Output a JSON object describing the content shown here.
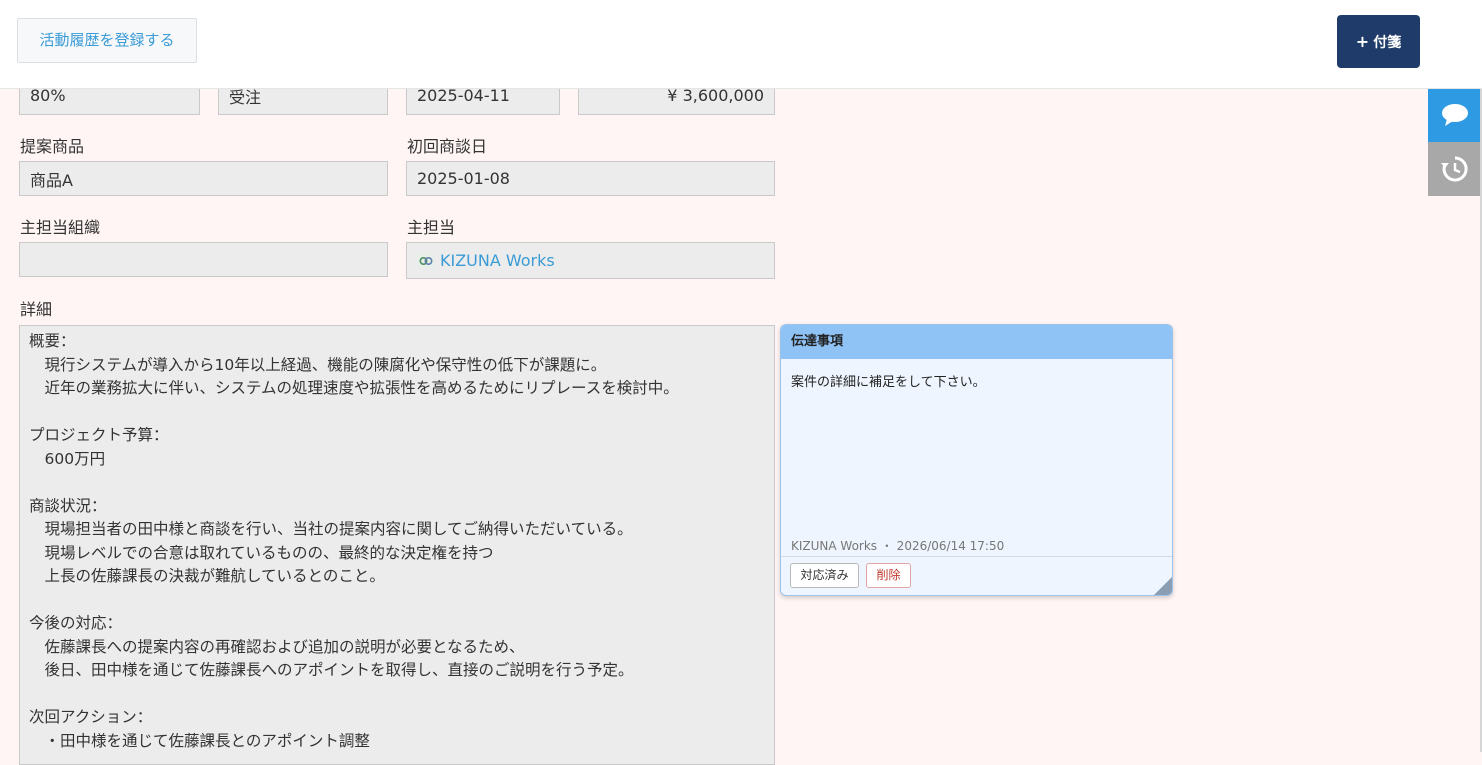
{
  "header": {
    "register_label": "活動履歴を登録する",
    "sticky_plus": "+",
    "sticky_label": "付箋"
  },
  "top_row": {
    "probability": "80%",
    "stage": "受注",
    "date": "2025-04-11",
    "amount": "¥ 3,600,000"
  },
  "form": {
    "product_label": "提案商品",
    "product_value": "商品A",
    "first_meeting_label": "初回商談日",
    "first_meeting_value": "2025-01-08",
    "org_label": "主担当組織",
    "org_value": "",
    "owner_label": "主担当",
    "owner_value": "KIZUNA Works",
    "detail_label": "詳細",
    "detail_lines": [
      "概要：",
      "　現行システムが導入から10年以上経過、機能の陳腐化や保守性の低下が課題に。",
      "　近年の業務拡大に伴い、システムの処理速度や拡張性を高めるためにリプレースを検討中。",
      "",
      "プロジェクト予算：",
      "　600万円",
      "",
      "商談状況：",
      "　現場担当者の田中様と商談を行い、当社の提案内容に関してご納得いただいている。",
      "　現場レベルでの合意は取れているものの、最終的な決定権を持つ",
      "　上長の佐藤課長の決裁が難航しているとのこと。",
      "",
      "今後の対応：",
      "　佐藤課長への提案内容の再確認および追加の説明が必要となるため、",
      "　後日、田中様を通じて佐藤課長へのアポイントを取得し、直接のご説明を行う予定。",
      "",
      "次回アクション：",
      "　・田中様を通じて佐藤課長とのアポイント調整"
    ]
  },
  "note": {
    "title": "伝達事項",
    "body": "案件の詳細に補足をして下さい。",
    "meta": "KIZUNA Works ・ 2026/06/14 17:50",
    "done_label": "対応済み",
    "delete_label": "削除"
  },
  "side_tabs": {
    "chat_icon": "chat-bubble-icon",
    "history_icon": "history-icon",
    "chat_color": "#2f9ae4",
    "history_color": "#a8a8a8"
  },
  "colors": {
    "accent": "#3a9bd6",
    "primary_button": "#1f3b6a",
    "note_header": "#8fc3f6",
    "page_background": "#fff5f4"
  }
}
